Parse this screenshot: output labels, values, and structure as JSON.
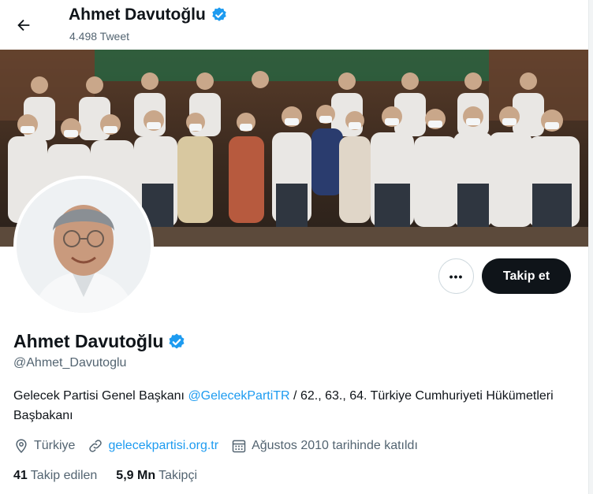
{
  "header": {
    "name": "Ahmet Davutoğlu",
    "tweet_count": "4.498 Tweet",
    "back_icon": "arrow-left-icon"
  },
  "banner": {
    "description_icon": "group-photo"
  },
  "profile": {
    "name": "Ahmet Davutoğlu",
    "handle": "@Ahmet_Davutoglu",
    "verified_icon": "verified-badge-icon",
    "bio_prefix": "Gelecek Partisi Genel Başkanı ",
    "bio_mention": "@GelecekPartiTR",
    "bio_suffix": " / 62., 63., 64. Türkiye Cumhuriyeti Hükümetleri Başbakanı",
    "location": "Türkiye",
    "website": "gelecekpartisi.org.tr",
    "joined": "Ağustos 2010 tarihinde katıldı"
  },
  "actions": {
    "more_label": "•••",
    "follow_label": "Takip et"
  },
  "stats": {
    "following_count": "41",
    "following_label": "Takip edilen",
    "followers_count": "5,9 Mn",
    "followers_label": "Takipçi"
  },
  "colors": {
    "accent": "#1d9bf0",
    "text_primary": "#0f1419",
    "text_secondary": "#536471",
    "button_dark": "#0f1419"
  }
}
